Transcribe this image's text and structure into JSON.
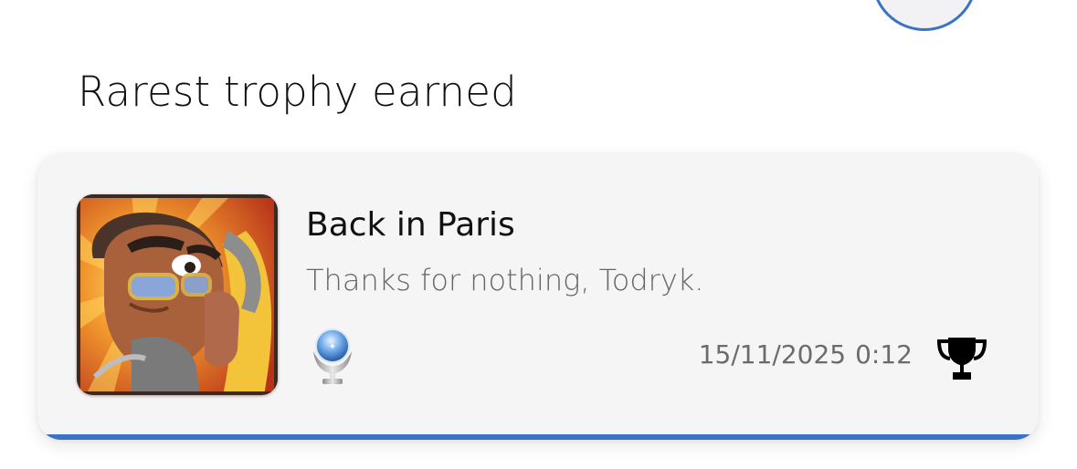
{
  "section": {
    "title": "Rarest trophy earned"
  },
  "trophy": {
    "name": "Back in Paris",
    "description": "Thanks for nothing, Todryk.",
    "grade": "platinum",
    "grade_icon": "platinum-trophy-icon",
    "earned_date": "15/11/2025",
    "earned_time": "0:12",
    "action_icon": "trophy-icon"
  },
  "colors": {
    "accent": "#3a72c4",
    "card_background": "#f5f5f6",
    "title_text": "#111111",
    "secondary_text": "#666666"
  }
}
